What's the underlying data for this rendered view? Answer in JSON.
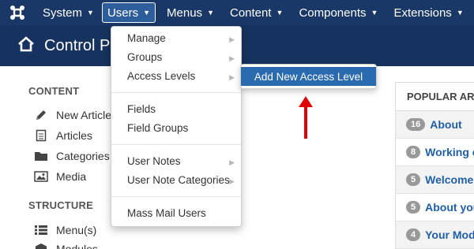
{
  "navbar": {
    "items": [
      {
        "label": "System"
      },
      {
        "label": "Users"
      },
      {
        "label": "Menus"
      },
      {
        "label": "Content"
      },
      {
        "label": "Components"
      },
      {
        "label": "Extensions"
      }
    ]
  },
  "header": {
    "title": "Control P"
  },
  "sidebar": {
    "content_title": "CONTENT",
    "content_items": [
      {
        "label": "New Article",
        "icon": "pencil-icon"
      },
      {
        "label": "Articles",
        "icon": "document-icon"
      },
      {
        "label": "Categories",
        "icon": "folder-icon"
      },
      {
        "label": "Media",
        "icon": "image-icon"
      }
    ],
    "structure_title": "STRUCTURE",
    "structure_items": [
      {
        "label": "Menu(s)",
        "icon": "list-icon"
      },
      {
        "label": "Modules",
        "icon": "cube-icon"
      }
    ]
  },
  "users_menu": {
    "items": [
      "Manage",
      "Groups",
      "Access Levels",
      "Fields",
      "Field Groups",
      "User Notes",
      "User Note Categories",
      "Mass Mail Users"
    ]
  },
  "access_submenu": {
    "item": "Add New Access Level"
  },
  "popular": {
    "title": "POPULAR ART",
    "rows": [
      {
        "count": "16",
        "title": "About"
      },
      {
        "count": "8",
        "title": "Working o"
      },
      {
        "count": "5",
        "title": "Welcome"
      },
      {
        "count": "5",
        "title": "About you"
      },
      {
        "count": "4",
        "title": "Your Mod"
      }
    ]
  },
  "colors": {
    "navbar": "#1a3867",
    "header": "#16335f",
    "accent": "#2a6aae",
    "annotation": "#e00000"
  }
}
